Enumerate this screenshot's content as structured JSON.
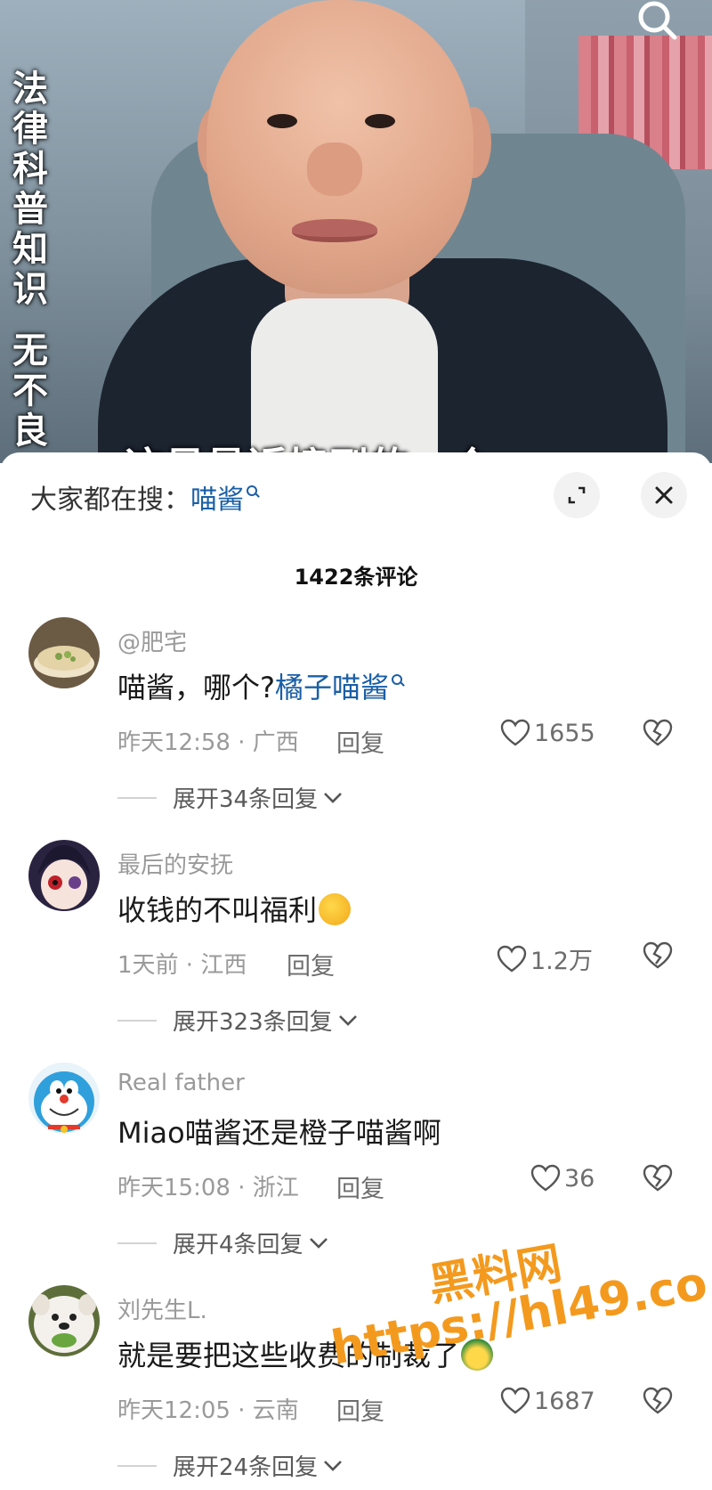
{
  "video": {
    "vertical_text_1": "法律科普知识",
    "vertical_text_2": "无不良",
    "caption": "这是最近接到的一个",
    "search_icon": "search-icon"
  },
  "sheet": {
    "hot_label": "大家都在搜：",
    "hot_term": "喵酱",
    "comment_count": "1422条评论",
    "icons": {
      "expand": "expand-icon",
      "close": "close-icon"
    }
  },
  "comments": [
    {
      "username": "@肥宅",
      "text": "喵酱，哪个?",
      "link_text": "橘子喵酱",
      "time_location": "昨天12:58 · 广西",
      "reply_label": "回复",
      "likes": "1655",
      "expand_label": "展开34条回复"
    },
    {
      "username": "最后的安抚",
      "text": "收钱的不叫福利",
      "emoji": "ok-hand-emoji",
      "time_location": "1天前 · 江西",
      "reply_label": "回复",
      "likes": "1.2万",
      "expand_label": "展开323条回复"
    },
    {
      "username": "Real father",
      "text": "Miao喵酱还是橙子喵酱啊",
      "time_location": "昨天15:08 · 浙江",
      "reply_label": "回复",
      "likes": "36",
      "expand_label": "展开4条回复"
    },
    {
      "username": "刘先生L.",
      "text": "就是要把这些收费的制裁了",
      "emoji": "angry-emoji",
      "time_location": "昨天12:05 · 云南",
      "reply_label": "回复",
      "likes": "1687",
      "expand_label": "展开24条回复"
    }
  ],
  "watermark": {
    "text_cn": "黑料网",
    "text_url": "https://hl49.co"
  },
  "colors": {
    "link": "#1b5fa6",
    "meta": "#9a9a9a",
    "watermark": "#f39a1e"
  }
}
